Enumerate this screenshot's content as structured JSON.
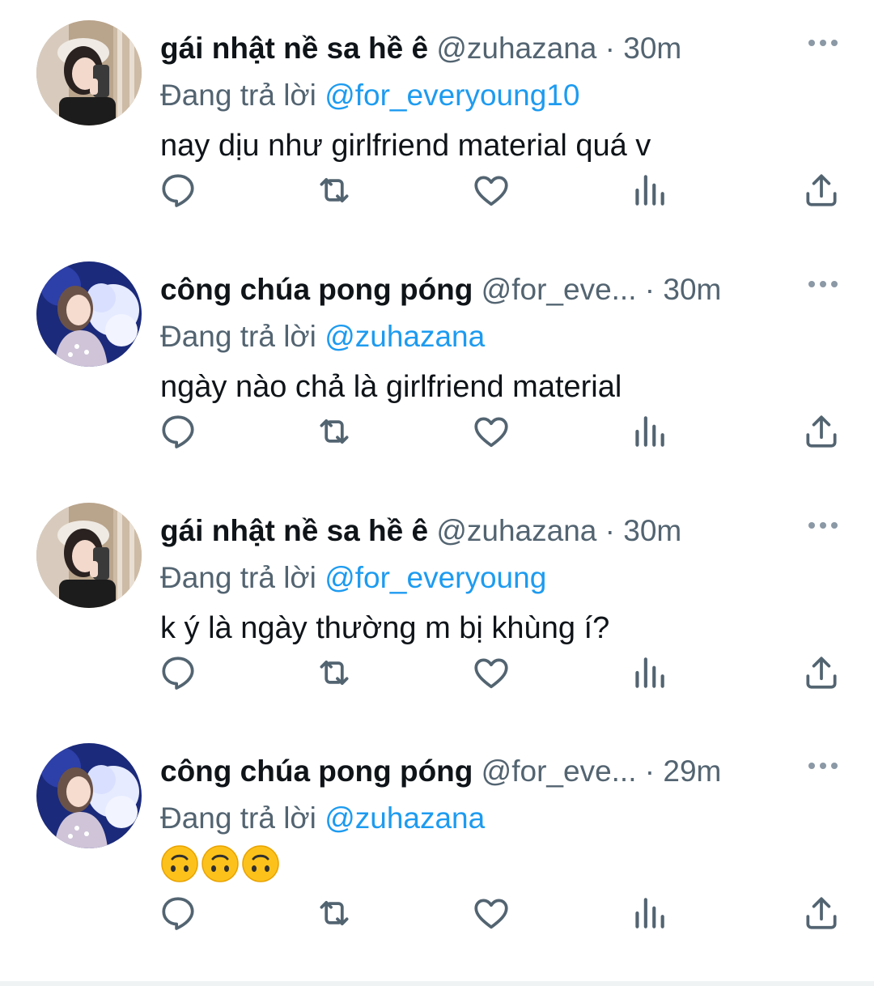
{
  "colors": {
    "text": "#0f1419",
    "secondary": "#536471",
    "link": "#1d9bf0"
  },
  "replying_prefix": "Đang trả lời",
  "tweets": [
    {
      "display_name": "gái nhật nề sa hề ê",
      "handle": "@zuhazana",
      "time": "30m",
      "replying_to": "@for_everyoung10",
      "text": "nay dịu như girlfriend material quá v",
      "avatar": "avatar-zuhazana"
    },
    {
      "display_name": "công chúa pong póng",
      "handle": "@for_eve...",
      "time": "30m",
      "replying_to": "@zuhazana",
      "text": "ngày nào chả là girlfriend material",
      "avatar": "avatar-for-everyoung"
    },
    {
      "display_name": "gái nhật nề sa hề ê",
      "handle": "@zuhazana",
      "time": "30m",
      "replying_to": "@for_everyoung",
      "text": "k ý là ngày thường m bị khùng í?",
      "avatar": "avatar-zuhazana"
    },
    {
      "display_name": "công chúa pong póng",
      "handle": "@for_eve...",
      "time": "29m",
      "replying_to": "@zuhazana",
      "text": "",
      "emojis": [
        "upside-down-face-emoji",
        "upside-down-face-emoji",
        "upside-down-face-emoji"
      ],
      "avatar": "avatar-for-everyoung"
    }
  ],
  "action_icons": [
    "reply-icon",
    "retweet-icon",
    "like-icon",
    "views-icon",
    "share-icon"
  ]
}
